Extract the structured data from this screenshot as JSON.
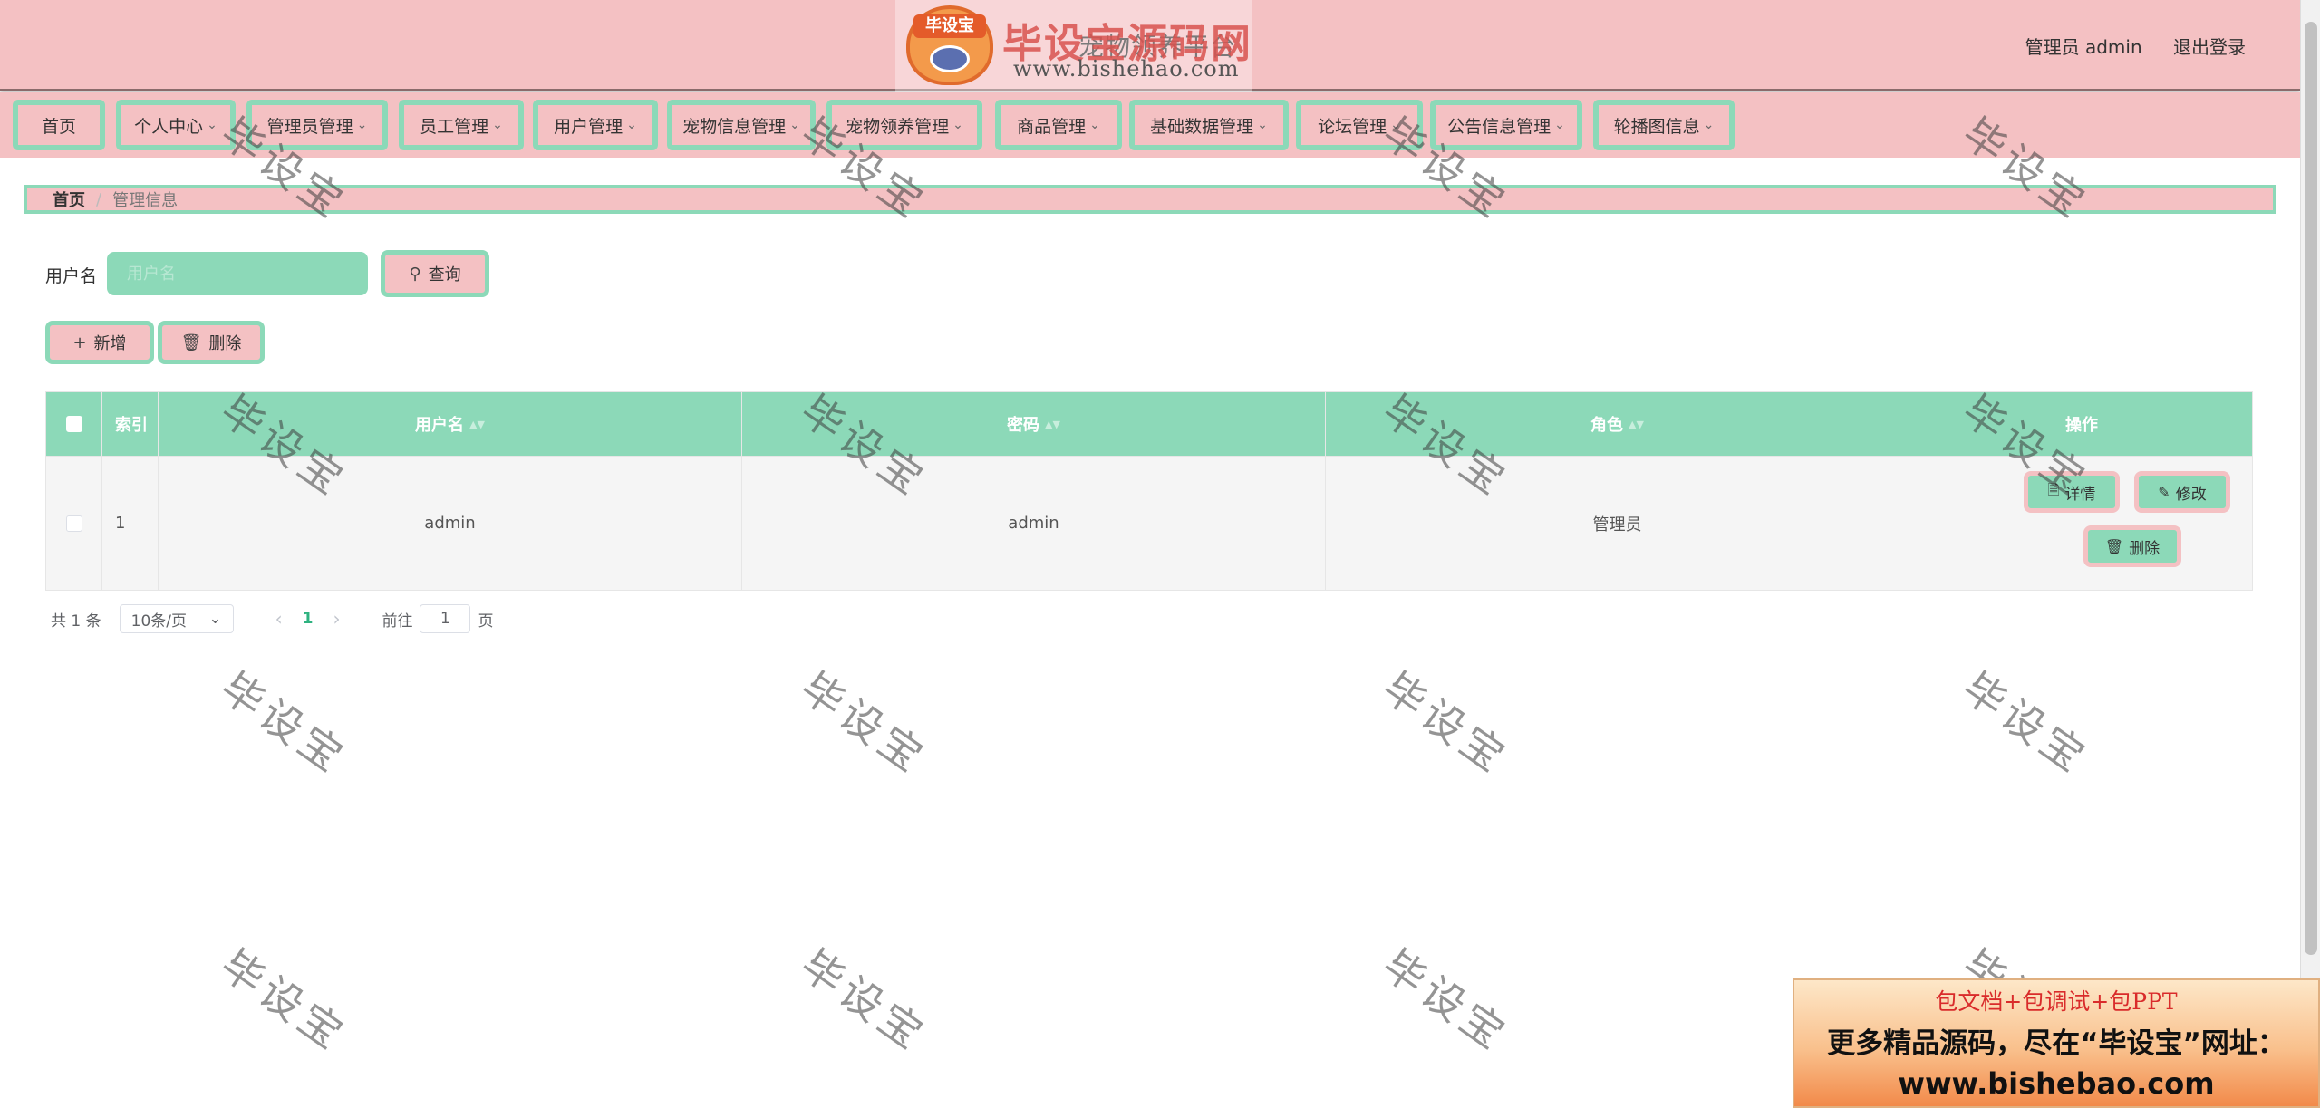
{
  "header": {
    "site_title": "宠物领养平台",
    "user_label": "管理员 admin",
    "logout_label": "退出登录"
  },
  "watermark_logo": {
    "badge_text": "毕设宝",
    "brand_text": "毕设宝源码网",
    "url_text": "www.bishehao.com"
  },
  "nav": {
    "items": [
      {
        "label": "首页",
        "has_dropdown": false
      },
      {
        "label": "个人中心",
        "has_dropdown": true
      },
      {
        "label": "管理员管理",
        "has_dropdown": true
      },
      {
        "label": "员工管理",
        "has_dropdown": true
      },
      {
        "label": "用户管理",
        "has_dropdown": true
      },
      {
        "label": "宠物信息管理",
        "has_dropdown": true
      },
      {
        "label": "宠物领养管理",
        "has_dropdown": true
      },
      {
        "label": "商品管理",
        "has_dropdown": true
      },
      {
        "label": "基础数据管理",
        "has_dropdown": true
      },
      {
        "label": "论坛管理",
        "has_dropdown": true
      },
      {
        "label": "公告信息管理",
        "has_dropdown": true
      },
      {
        "label": "轮播图信息",
        "has_dropdown": true
      }
    ]
  },
  "breadcrumb": {
    "home": "首页",
    "separator": "/",
    "current": "管理信息"
  },
  "search": {
    "label": "用户名",
    "placeholder": "用户名",
    "value": "",
    "button_label": "查询"
  },
  "actions": {
    "add_label": "新增",
    "delete_label": "删除"
  },
  "table": {
    "columns": [
      "索引",
      "用户名",
      "密码",
      "角色",
      "操作"
    ],
    "rows": [
      {
        "index": "1",
        "username": "admin",
        "password": "admin",
        "role": "管理员",
        "ops": {
          "detail": "详情",
          "edit": "修改",
          "delete": "删除"
        }
      }
    ]
  },
  "pagination": {
    "total_text": "共 1 条",
    "page_size": "10条/页",
    "current_page": "1",
    "goto_label": "前往",
    "goto_value": "1",
    "page_unit": "页"
  },
  "watermark_text": "毕设宝",
  "ad": {
    "line1": "包文档+包调试+包PPT",
    "line2": "更多精品源码，尽在“毕设宝”网址：",
    "line3": "www.bishebao.com"
  },
  "colors": {
    "pink": "#f4c1c3",
    "mint": "#8cd9b8",
    "accent_green": "#2fb280"
  }
}
